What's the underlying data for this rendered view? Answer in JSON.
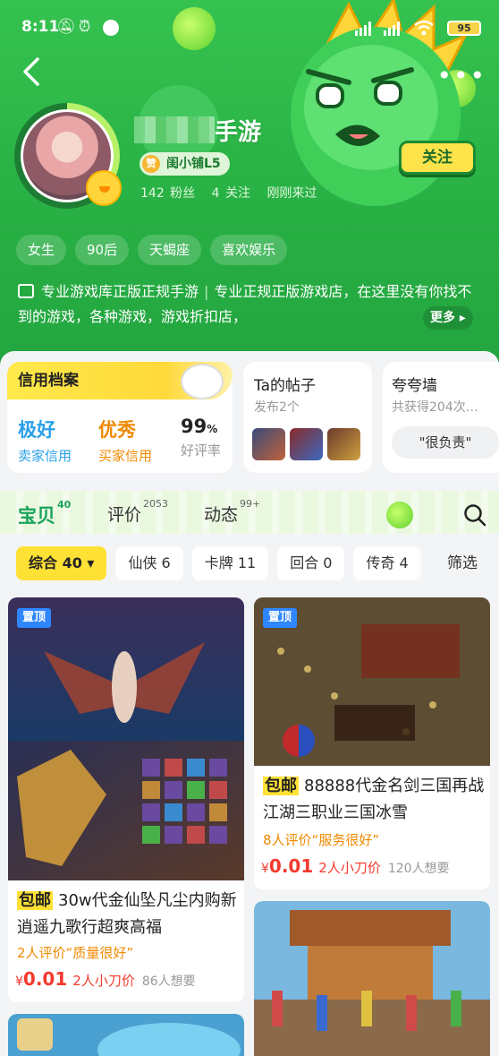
{
  "status_bar": {
    "time": "8:11",
    "battery": "95"
  },
  "profile": {
    "name_visible": "手游",
    "level": "闺小铺L5",
    "level_badge": "赞",
    "fans": "142 粉丝",
    "follows": "4 关注",
    "last_seen": "刚刚来过",
    "follow_label": "关注",
    "tags": [
      "女生",
      "90后",
      "天蝎座",
      "喜欢娱乐"
    ],
    "desc_part1": "专业游戏库正版正规手游",
    "desc_part2": "专业正规正版游戏店，在这里没有你找不到的游戏，各种游戏，游戏折扣店，",
    "more_label": "更多"
  },
  "credit": {
    "title": "信用档案",
    "seller_value": "极好",
    "seller_label": "卖家信用",
    "buyer_value": "优秀",
    "buyer_label": "买家信用",
    "rate_value": "99",
    "rate_unit": "%",
    "rate_label": "好评率"
  },
  "posts": {
    "title": "Ta的帖子",
    "subtitle": "发布2个"
  },
  "praise": {
    "title": "夸夸墙",
    "subtitle": "共获得204次…",
    "top_comment": "\"很负责\""
  },
  "tabs": [
    {
      "label": "宝贝",
      "count": "40"
    },
    {
      "label": "评价",
      "count": "2053"
    },
    {
      "label": "动态",
      "count": "99+"
    }
  ],
  "filters": [
    "综合 40",
    "仙侠 6",
    "卡牌 11",
    "回合 0",
    "传奇 4"
  ],
  "filter_label": "筛选",
  "items": [
    {
      "pin": "置顶",
      "tag": "包邮",
      "title": "30w代金仙坠凡尘内购新逍遥九歌行超爽高福",
      "review": "2人评价“质量很好”",
      "currency": "¥",
      "price": "0.01",
      "bargain": "2人小刀价",
      "wants": "86人想要"
    },
    {
      "pin": "置顶",
      "tag": "包邮",
      "title": "88888代金名剑三国再战江湖三职业三国冰雪",
      "review": "8人评价“服务很好”",
      "currency": "¥",
      "price": "0.01",
      "bargain": "2人小刀价",
      "wants": "120人想要"
    }
  ],
  "colors": {
    "brand_green": "#2bb54a",
    "accent_yellow": "#ffe135",
    "price_red": "#f33a2e",
    "review_orange": "#f08a00"
  }
}
